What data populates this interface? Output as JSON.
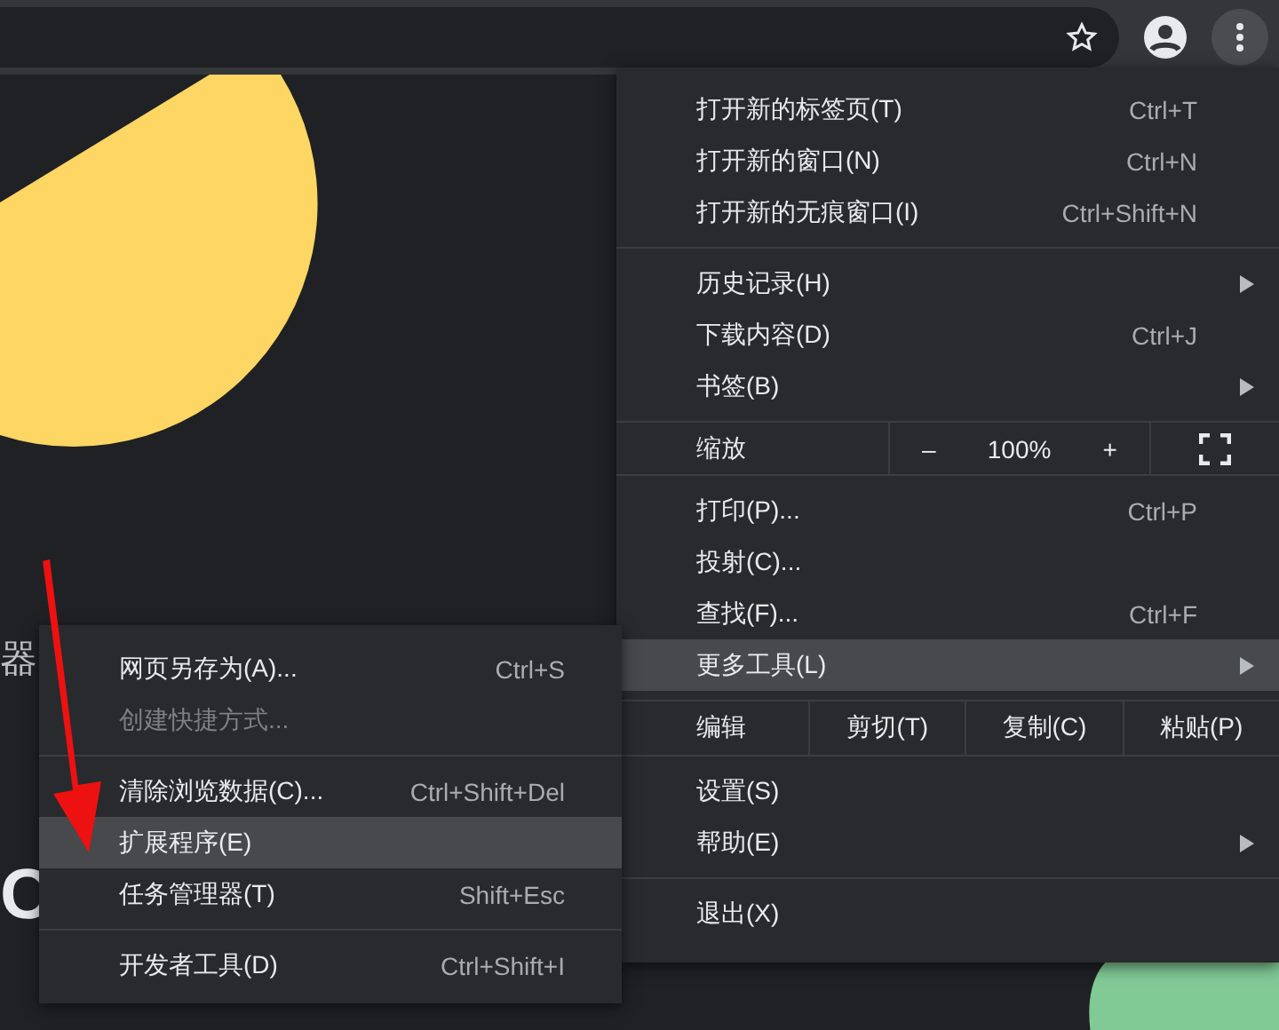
{
  "toolbar": {
    "bookmark": false
  },
  "page": {
    "texts": [
      {
        "kind": "caption",
        "text": "器"
      },
      {
        "kind": "headline",
        "text": "C"
      }
    ]
  },
  "menu": {
    "sections": [
      {
        "items": [
          {
            "kind": "item",
            "label": "打开新的标签页(T)",
            "shortcut": "Ctrl+T",
            "submenu": false,
            "selected": false
          },
          {
            "kind": "item",
            "label": "打开新的窗口(N)",
            "shortcut": "Ctrl+N",
            "submenu": false,
            "selected": false
          },
          {
            "kind": "item",
            "label": "打开新的无痕窗口(I)",
            "shortcut": "Ctrl+Shift+N",
            "submenu": false,
            "selected": false
          }
        ]
      },
      {
        "items": [
          {
            "kind": "item",
            "label": "历史记录(H)",
            "submenu": true,
            "selected": false
          },
          {
            "kind": "item",
            "label": "下载内容(D)",
            "shortcut": "Ctrl+J",
            "submenu": false,
            "selected": false
          },
          {
            "kind": "item",
            "label": "书签(B)",
            "submenu": true,
            "selected": false
          }
        ]
      },
      {
        "items": [
          {
            "kind": "zoom",
            "label": "缩放",
            "minus": "–",
            "value": "100%",
            "plus": "+"
          }
        ]
      },
      {
        "items": [
          {
            "kind": "item",
            "label": "打印(P)...",
            "shortcut": "Ctrl+P",
            "submenu": false,
            "selected": false
          },
          {
            "kind": "item",
            "label": "投射(C)...",
            "submenu": false,
            "selected": false
          },
          {
            "kind": "item",
            "label": "查找(F)...",
            "shortcut": "Ctrl+F",
            "submenu": false,
            "selected": false
          },
          {
            "kind": "item",
            "label": "更多工具(L)",
            "submenu": true,
            "selected": true
          }
        ]
      },
      {
        "items": [
          {
            "kind": "edit",
            "label": "编辑",
            "actions": [
              "剪切(T)",
              "复制(C)",
              "粘贴(P)"
            ]
          }
        ]
      },
      {
        "items": [
          {
            "kind": "item",
            "label": "设置(S)",
            "submenu": false,
            "selected": false
          },
          {
            "kind": "item",
            "label": "帮助(E)",
            "submenu": true,
            "selected": false
          }
        ]
      },
      {
        "items": [
          {
            "kind": "item",
            "label": "退出(X)",
            "submenu": false,
            "selected": false
          }
        ]
      }
    ]
  },
  "submenu": {
    "sections": [
      {
        "items": [
          {
            "kind": "item",
            "label": "网页另存为(A)...",
            "shortcut": "Ctrl+S",
            "disabled": false,
            "selected": false
          },
          {
            "kind": "item",
            "label": "创建快捷方式...",
            "disabled": true,
            "selected": false
          }
        ]
      },
      {
        "items": [
          {
            "kind": "item",
            "label": "清除浏览数据(C)...",
            "shortcut": "Ctrl+Shift+Del",
            "disabled": false,
            "selected": false
          },
          {
            "kind": "item",
            "label": "扩展程序(E)",
            "disabled": false,
            "selected": true
          },
          {
            "kind": "item",
            "label": "任务管理器(T)",
            "shortcut": "Shift+Esc",
            "disabled": false,
            "selected": false
          }
        ]
      },
      {
        "items": [
          {
            "kind": "item",
            "label": "开发者工具(D)",
            "shortcut": "Ctrl+Shift+I",
            "disabled": false,
            "selected": false
          }
        ]
      }
    ]
  }
}
